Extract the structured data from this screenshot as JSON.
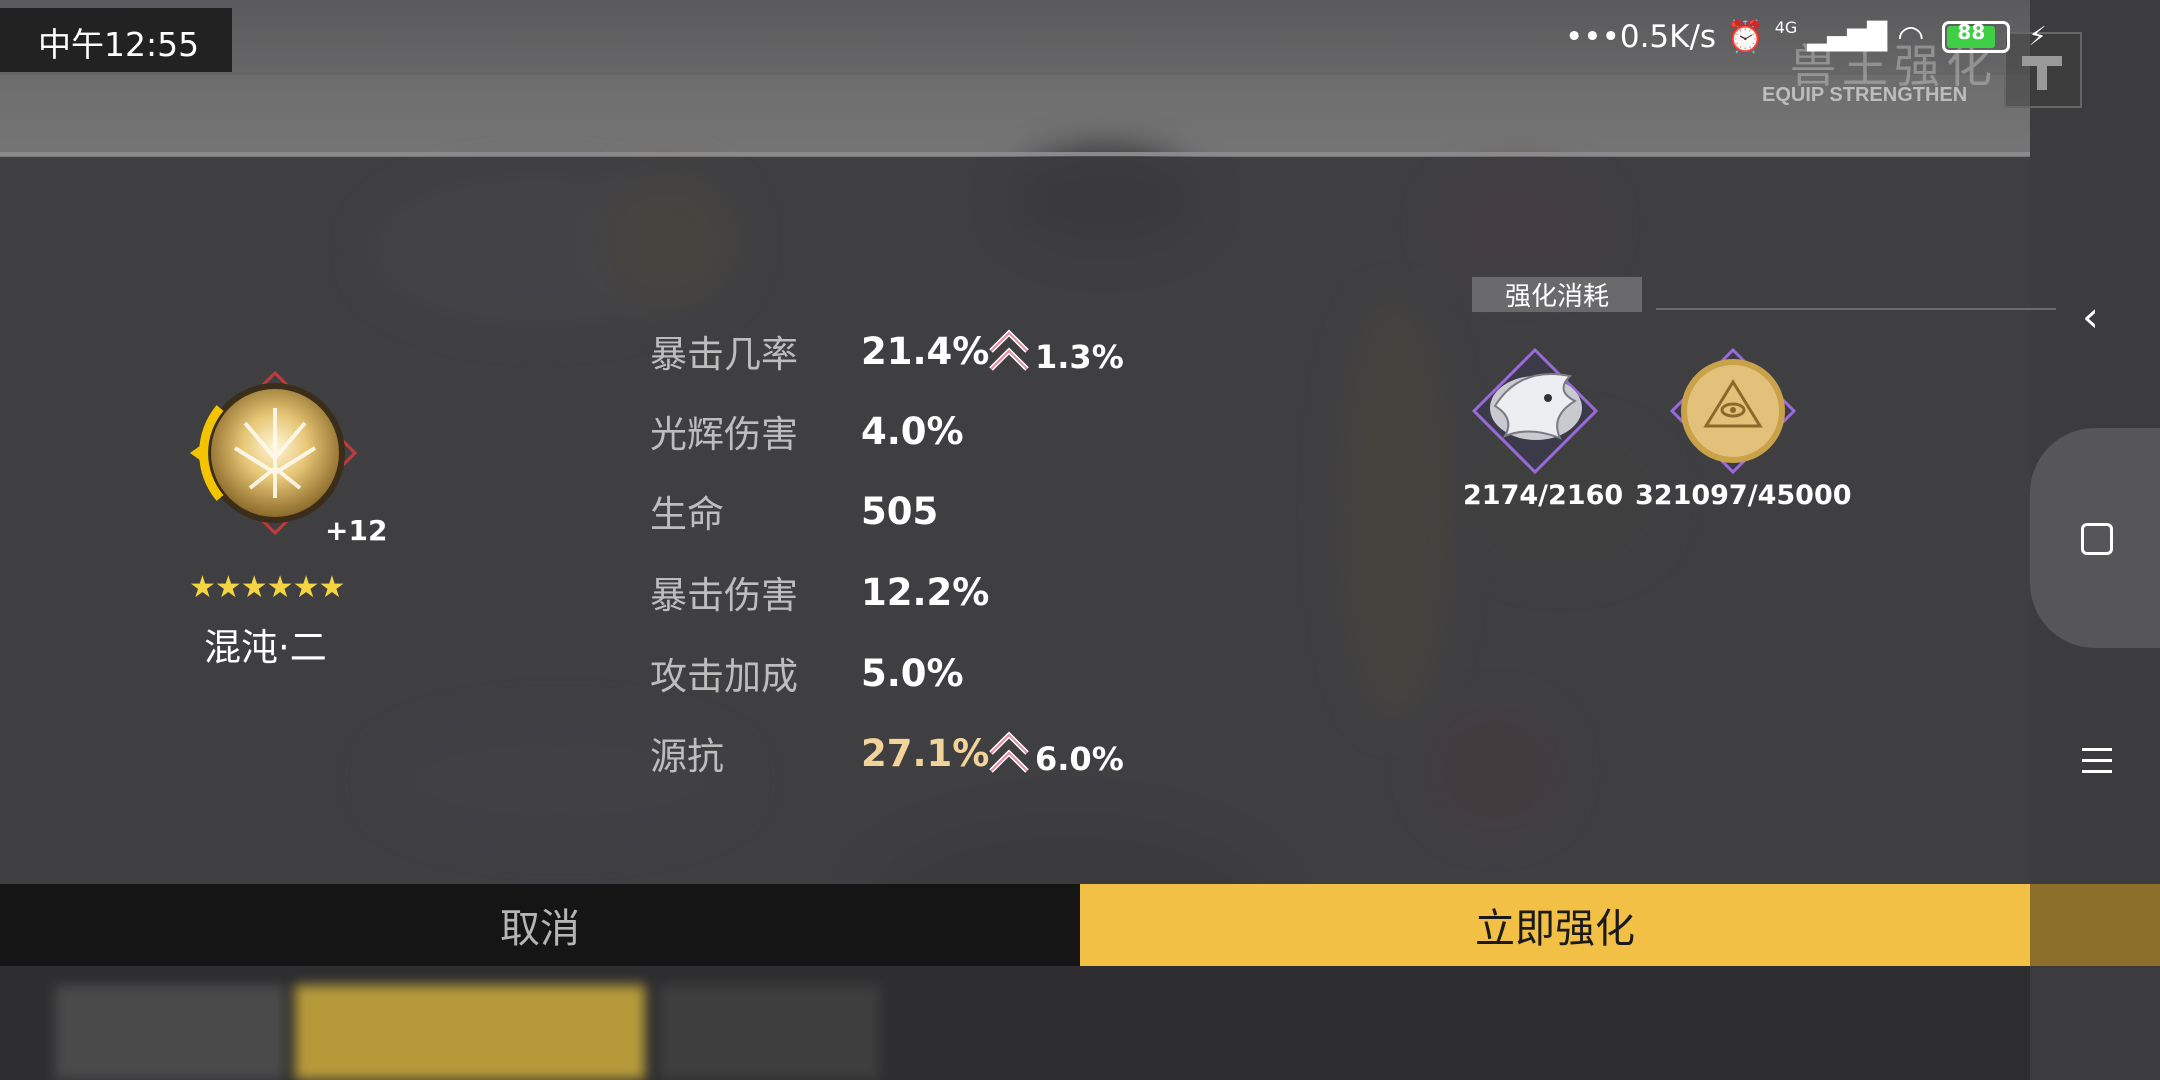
{
  "status_bar": {
    "time": "中午12:55",
    "network_speed": "•••0.5K/s",
    "network_type": "4G",
    "battery": "88"
  },
  "header": {
    "title_cn": "兽王强化",
    "title_en": "EQUIP STRENGTHEN"
  },
  "item": {
    "level": "+12",
    "stars": "★★★★★★",
    "name": "混沌·二"
  },
  "stats": [
    {
      "label": "暴击几率",
      "value": "21.4%",
      "increase": "1.3%"
    },
    {
      "label": "光辉伤害",
      "value": "4.0%",
      "increase": ""
    },
    {
      "label": "生命",
      "value": "505",
      "increase": ""
    },
    {
      "label": "暴击伤害",
      "value": "12.2%",
      "increase": ""
    },
    {
      "label": "攻击加成",
      "value": "5.0%",
      "increase": ""
    },
    {
      "label": "源抗",
      "value": "27.1%",
      "increase": "6.0%"
    }
  ],
  "cost": {
    "title": "强化消耗",
    "items": [
      {
        "icon": "dragon-material-icon",
        "count": "2174/2160"
      },
      {
        "icon": "gold-coin-icon",
        "count": "321097/45000"
      }
    ]
  },
  "buttons": {
    "cancel": "取消",
    "confirm": "立即强化"
  },
  "colors": {
    "confirm_bg": "#f2c044",
    "highlight_value": "#f2d49a"
  }
}
